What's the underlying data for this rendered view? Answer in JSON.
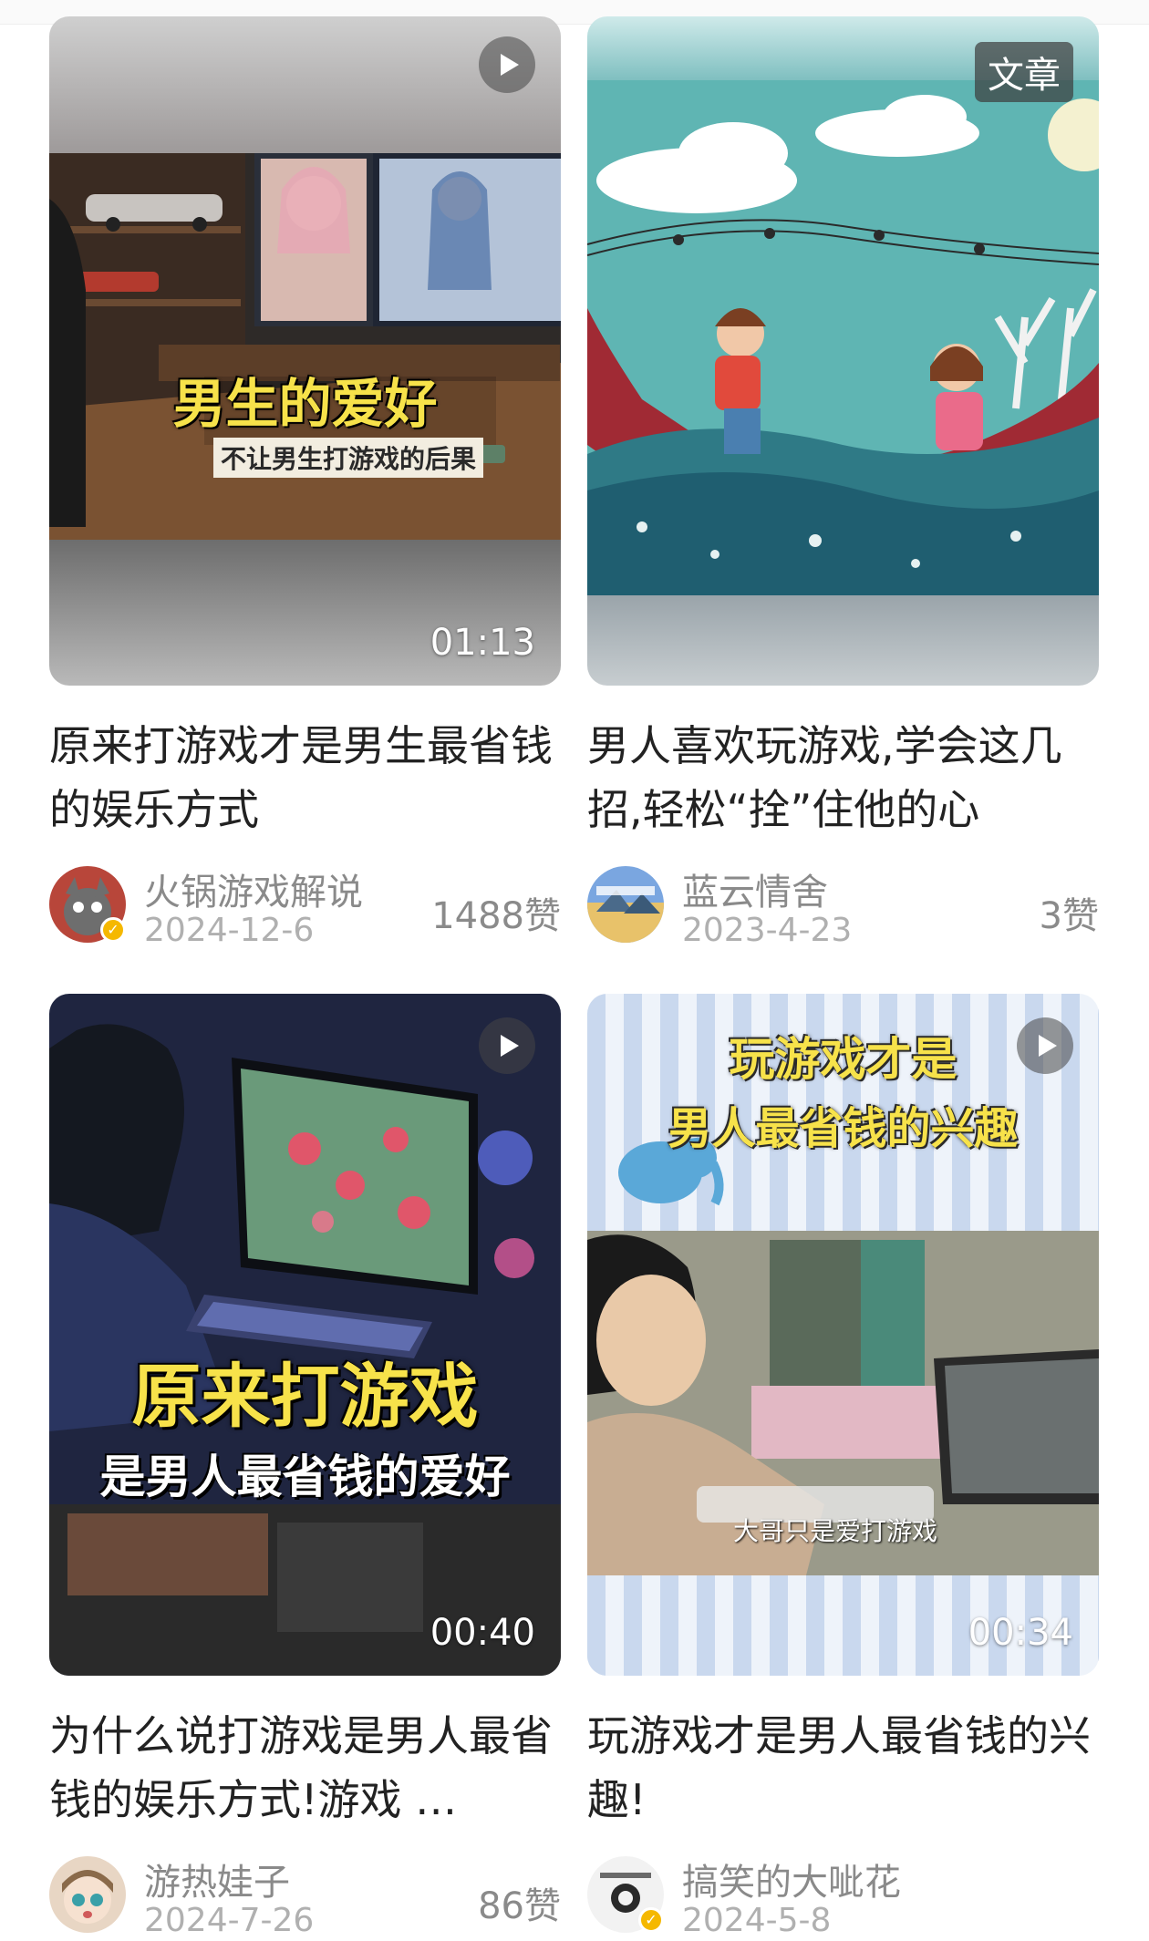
{
  "cards": [
    {
      "type": "video",
      "duration": "01:13",
      "overlay_title": "男生的爱好",
      "overlay_subtitle": "不让男生打游戏的后果",
      "title": "原来打游戏才是男生最省钱的娱乐方式",
      "author": "火锅游戏解说",
      "date": "2024-12-6",
      "likes": "1488赞",
      "verified": true
    },
    {
      "type": "article",
      "badge": "文章",
      "title": "男人喜欢玩游戏,学会这几招,轻松“拴”住他的心",
      "author": "蓝云情舍",
      "date": "2023-4-23",
      "likes": "3赞",
      "verified": false
    },
    {
      "type": "video",
      "duration": "00:40",
      "overlay_title": "原来打游戏",
      "overlay_subtitle": "是男人最省钱的爱好",
      "title": "为什么说打游戏是男人最省钱的娱乐方式!游戏 …",
      "author": "游热娃子",
      "date": "2024-7-26",
      "likes": "86赞",
      "verified": false
    },
    {
      "type": "video",
      "duration": "00:34",
      "overlay_title": "玩游戏才是",
      "overlay_subtitle": "男人最省钱的兴趣",
      "caption": "大哥只是爱打游戏",
      "title": "玩游戏才是男人最省钱的兴趣!",
      "author": "搞笑的大呲花",
      "date": "2024-5-8",
      "likes": "",
      "verified": true
    }
  ],
  "colors": {
    "title_text": "#222222",
    "meta_text": "#8a8a8a",
    "date_text": "#b0b0b0",
    "overlay_yellow": "#f7e24a",
    "verified_badge": "#f5b800"
  },
  "icons": [
    "play-icon",
    "verified-icon"
  ]
}
